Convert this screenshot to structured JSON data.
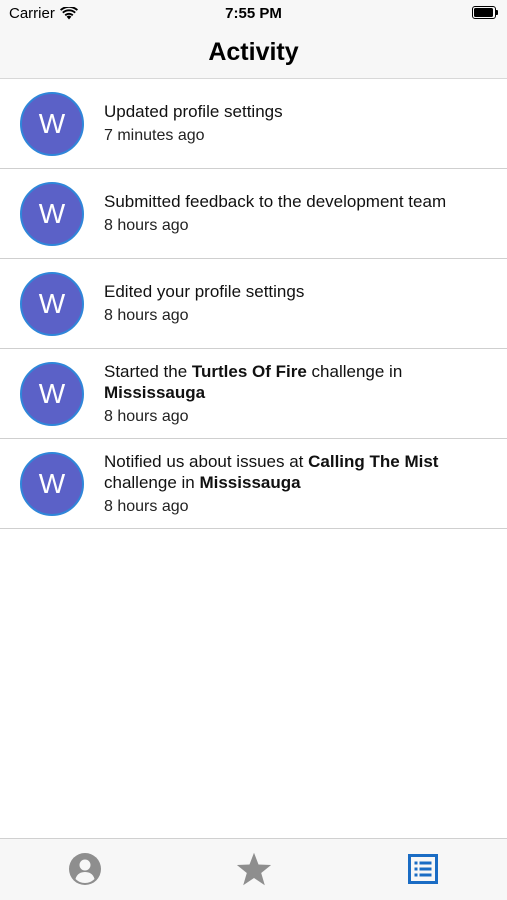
{
  "status_bar": {
    "carrier": "Carrier",
    "time": "7:55 PM"
  },
  "nav": {
    "title": "Activity"
  },
  "activities": [
    {
      "avatar_letter": "W",
      "parts": [
        {
          "text": "Updated profile settings",
          "bold": false
        }
      ],
      "time": "7 minutes ago"
    },
    {
      "avatar_letter": "W",
      "parts": [
        {
          "text": "Submitted feedback to the development team",
          "bold": false
        }
      ],
      "time": "8 hours ago"
    },
    {
      "avatar_letter": "W",
      "parts": [
        {
          "text": "Edited your profile settings",
          "bold": false
        }
      ],
      "time": "8 hours ago"
    },
    {
      "avatar_letter": "W",
      "parts": [
        {
          "text": "Started the ",
          "bold": false
        },
        {
          "text": "Turtles Of Fire",
          "bold": true
        },
        {
          "text": " challenge in ",
          "bold": false
        },
        {
          "text": "Mississauga",
          "bold": true
        }
      ],
      "time": "8 hours ago"
    },
    {
      "avatar_letter": "W",
      "parts": [
        {
          "text": "Notified us about issues at ",
          "bold": false
        },
        {
          "text": "Calling The Mist",
          "bold": true
        },
        {
          "text": " challenge in ",
          "bold": false
        },
        {
          "text": "Mississauga",
          "bold": true
        }
      ],
      "time": "8 hours ago"
    }
  ],
  "tab_bar": {
    "tabs": [
      {
        "name": "profile",
        "icon": "user-circle-icon",
        "active": false
      },
      {
        "name": "favorites",
        "icon": "star-icon",
        "active": false
      },
      {
        "name": "activity",
        "icon": "list-icon",
        "active": true
      }
    ]
  },
  "colors": {
    "avatar_bg": "#5b61c7",
    "avatar_border": "#2f86d9",
    "tab_active": "#1a6cc4",
    "tab_inactive": "#8e8e8e"
  }
}
